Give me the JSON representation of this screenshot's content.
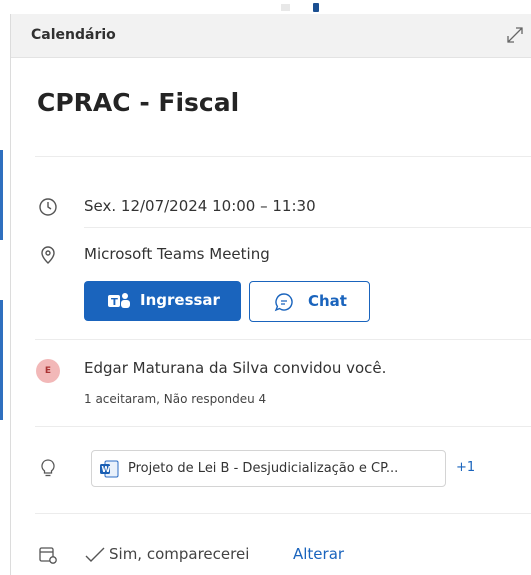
{
  "panel": {
    "header_title": "Calendário",
    "expand_icon": "expand-diagonal-icon"
  },
  "event": {
    "title": "CPRAC - Fiscal",
    "time": "Sex. 12/07/2024 10:00 – 11:30",
    "location": "Microsoft Teams Meeting"
  },
  "actions": {
    "join_label": "Ingressar",
    "chat_label": "Chat"
  },
  "organizer": {
    "initial": "E",
    "invite_text": "Edgar Maturana da Silva convidou você.",
    "responses": "1 aceitaram, Não respondeu 4"
  },
  "attachments": {
    "file_name": "Projeto de Lei B - Desjudicialização e CP...",
    "more_count": "+1"
  },
  "rsvp": {
    "status": "Sim, comparecerei",
    "change_label": "Alterar"
  },
  "colors": {
    "accent": "#1a64bd",
    "avatar_bg": "#f2b8b8",
    "header_bg": "#f2f2f2"
  }
}
